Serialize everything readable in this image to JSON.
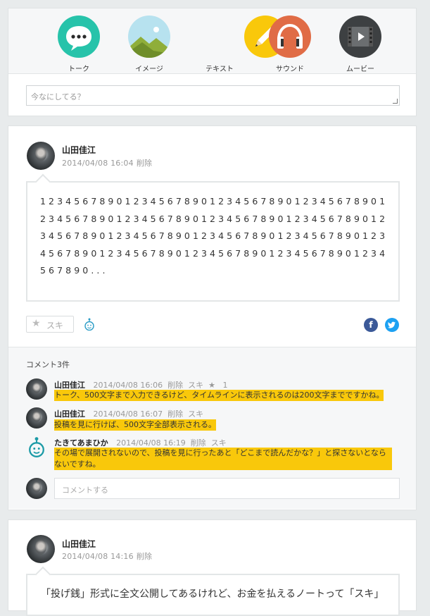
{
  "composer": {
    "types": [
      {
        "label": "トーク",
        "icon": "talk-icon"
      },
      {
        "label": "イメージ",
        "icon": "image-icon"
      },
      {
        "label": "テキスト",
        "icon": "text-icon"
      },
      {
        "label": "サウンド",
        "icon": "sound-icon"
      },
      {
        "label": "ムービー",
        "icon": "movie-icon"
      }
    ],
    "placeholder": "今なにしてる？"
  },
  "post1": {
    "author": "山田佳江",
    "datetime": "2014/04/08 16:04",
    "delete_label": "削除",
    "body": "12345678901234567890123456789012345678901234567890123456789012345678901234567890123456789012345678901234567890123456789012345678901234567890123456789012345678901234567890...",
    "like_label": "スキ",
    "comments_count_label": "コメント3件",
    "comments": [
      {
        "author": "山田佳江",
        "datetime": "2014/04/08 16:06",
        "delete_label": "削除",
        "like_label": "スキ",
        "like_count": "1",
        "text": "トーク、500文字まで入力できるけど、タイムラインに表示されるのは200文字までですかね。"
      },
      {
        "author": "山田佳江",
        "datetime": "2014/04/08 16:07",
        "delete_label": "削除",
        "like_label": "スキ",
        "text": "投稿を見に行けば、500文字全部表示される。"
      },
      {
        "author": "たきてあまひか",
        "datetime": "2014/04/08 16:19",
        "delete_label": "削除",
        "like_label": "スキ",
        "text": "その場で展開されないので、投稿を見に行ったあと「どこまで読んだかな？」と探さないとならないですね。"
      }
    ],
    "comment_placeholder": "コメントする"
  },
  "post2": {
    "author": "山田佳江",
    "datetime": "2014/04/08 14:16",
    "delete_label": "削除",
    "body": "「投げ銭」形式に全文公開してあるけれど、お金を払えるノートって「スキ」"
  },
  "colors": {
    "talk": "#27c3aa",
    "image": "#b7e2ef",
    "text": "#f9c80b",
    "sound": "#e06c46",
    "movie": "#3d4042",
    "facebook": "#3b5998",
    "twitter": "#1da1f2"
  }
}
